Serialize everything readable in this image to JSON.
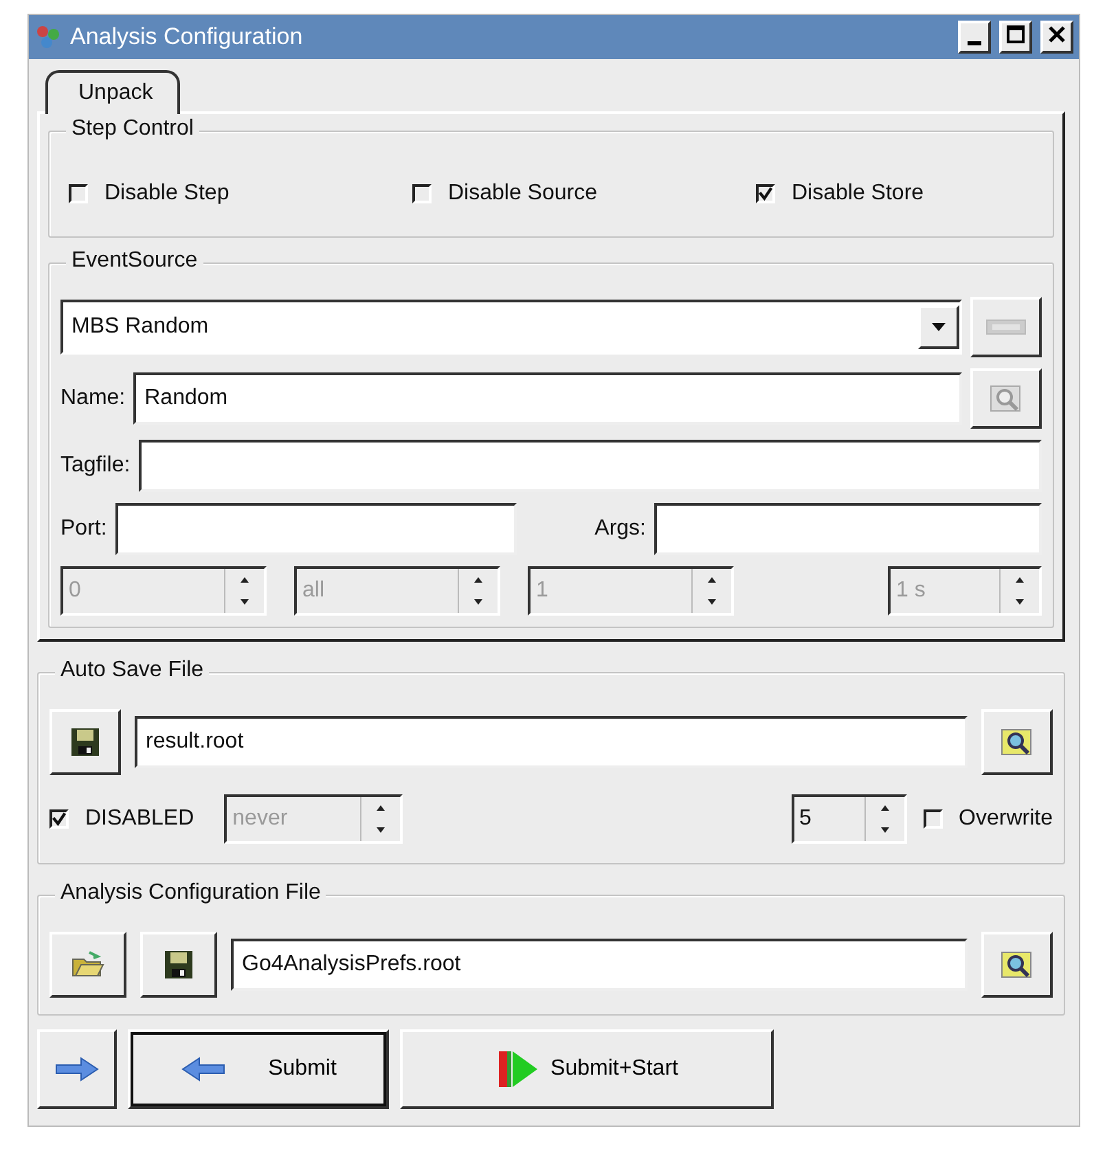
{
  "window": {
    "title": "Analysis Configuration"
  },
  "tabs": [
    {
      "label": "Unpack",
      "selected": true
    }
  ],
  "step_control": {
    "title": "Step Control",
    "checkboxes": [
      {
        "label": "Disable Step",
        "checked": false
      },
      {
        "label": "Disable Source",
        "checked": false
      },
      {
        "label": "Disable Store",
        "checked": true
      }
    ]
  },
  "event_source": {
    "title": "EventSource",
    "source_type": "MBS Random",
    "name_label": "Name:",
    "name_value": "Random",
    "tagfile_label": "Tagfile:",
    "port_label": "Port:",
    "args_label": "Args:",
    "spinboxes": [
      {
        "value": "0",
        "disabled": true
      },
      {
        "value": "all",
        "disabled": true
      },
      {
        "value": "1",
        "disabled": true
      },
      {
        "value": "1 s",
        "disabled": true
      }
    ]
  },
  "auto_save": {
    "title": "Auto Save File",
    "file": "result.root",
    "disabled_check": {
      "label": "DISABLED",
      "checked": true
    },
    "interval": {
      "value": "never",
      "disabled": true
    },
    "compression": {
      "value": "5",
      "disabled": false
    },
    "overwrite": {
      "label": "Overwrite",
      "checked": false
    }
  },
  "config_file": {
    "title": "Analysis Configuration File",
    "file": "Go4AnalysisPrefs.root"
  },
  "buttons": [
    {
      "label": "Submit"
    },
    {
      "label": "Submit+Start"
    }
  ]
}
